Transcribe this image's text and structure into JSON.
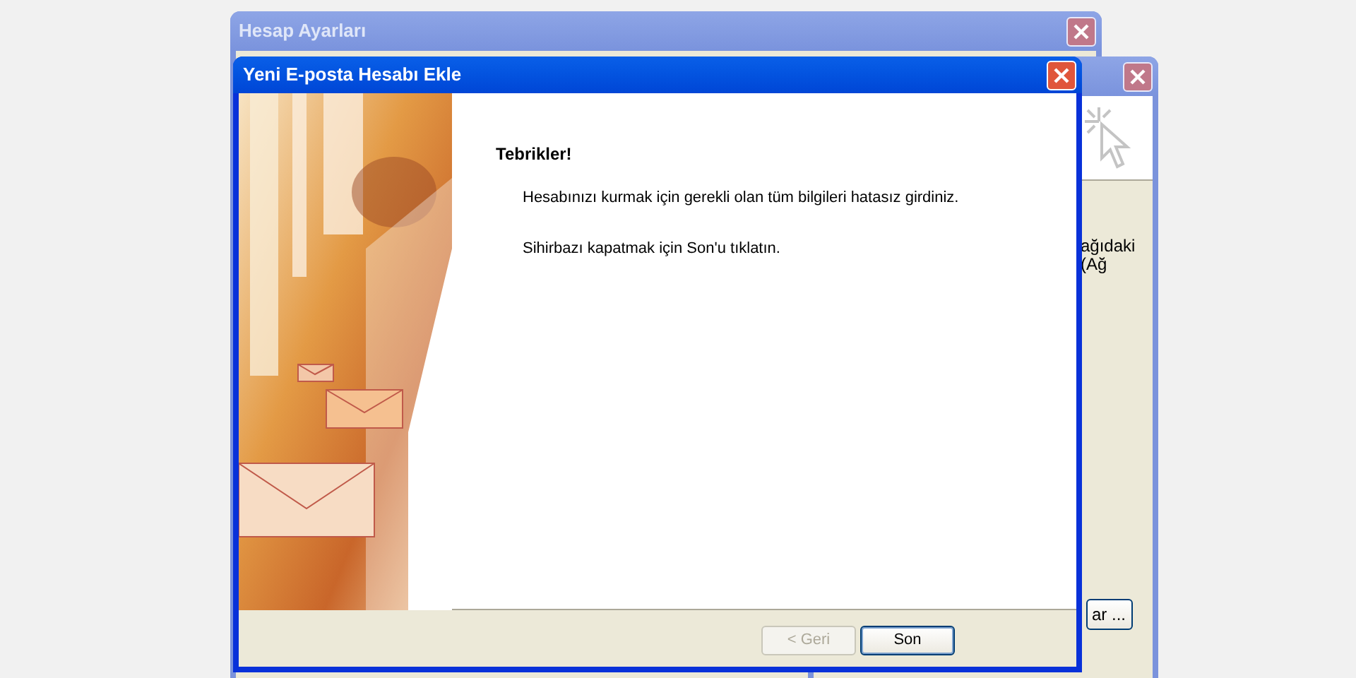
{
  "back_window": {
    "title": "Hesap Ayarları",
    "active": false
  },
  "middle_window": {
    "active": false,
    "texts": [
      "ağıdaki",
      "(Ağ"
    ],
    "button": "ar ..."
  },
  "wizard": {
    "title": "Yeni E-posta Hesabı Ekle",
    "active": true,
    "heading": "Tebrikler!",
    "paragraphs": [
      "Hesabınızı kurmak için gerekli olan tüm bilgileri hatasız girdiniz.",
      "Sihirbazı kapatmak için Son'u tıklatın."
    ],
    "buttons": [
      {
        "label": "< Geri",
        "disabled": true
      },
      {
        "label": "Son",
        "disabled": false,
        "default": true
      }
    ]
  }
}
